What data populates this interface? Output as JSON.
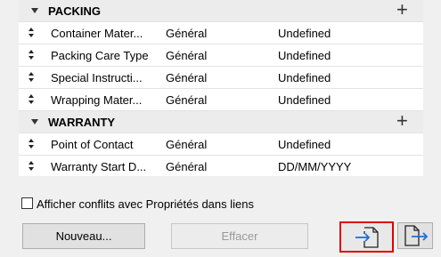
{
  "sections": [
    {
      "title": "PACKING",
      "rows": [
        {
          "name": "Container Mater...",
          "group": "Général",
          "value": "Undefined"
        },
        {
          "name": "Packing Care Type",
          "group": "Général",
          "value": "Undefined"
        },
        {
          "name": "Special Instructi...",
          "group": "Général",
          "value": "Undefined"
        },
        {
          "name": "Wrapping Mater...",
          "group": "Général",
          "value": "Undefined"
        }
      ]
    },
    {
      "title": "WARRANTY",
      "rows": [
        {
          "name": "Point of Contact",
          "group": "Général",
          "value": "Undefined"
        },
        {
          "name": "Warranty Start D...",
          "group": "Général",
          "value": "DD/MM/YYYY"
        }
      ]
    }
  ],
  "checkbox": {
    "label": "Afficher conflits avec Propriétés dans liens",
    "checked": false
  },
  "buttons": {
    "new_label": "Nouveau...",
    "delete_label": "Effacer"
  },
  "colors": {
    "highlight": "#e00000",
    "icon_blue": "#1f6fd1"
  },
  "icons": {
    "add": "plus-icon",
    "collapse": "triangle-down-icon",
    "sort": "sort-arrows-icon",
    "import": "import-icon",
    "export": "export-icon"
  }
}
